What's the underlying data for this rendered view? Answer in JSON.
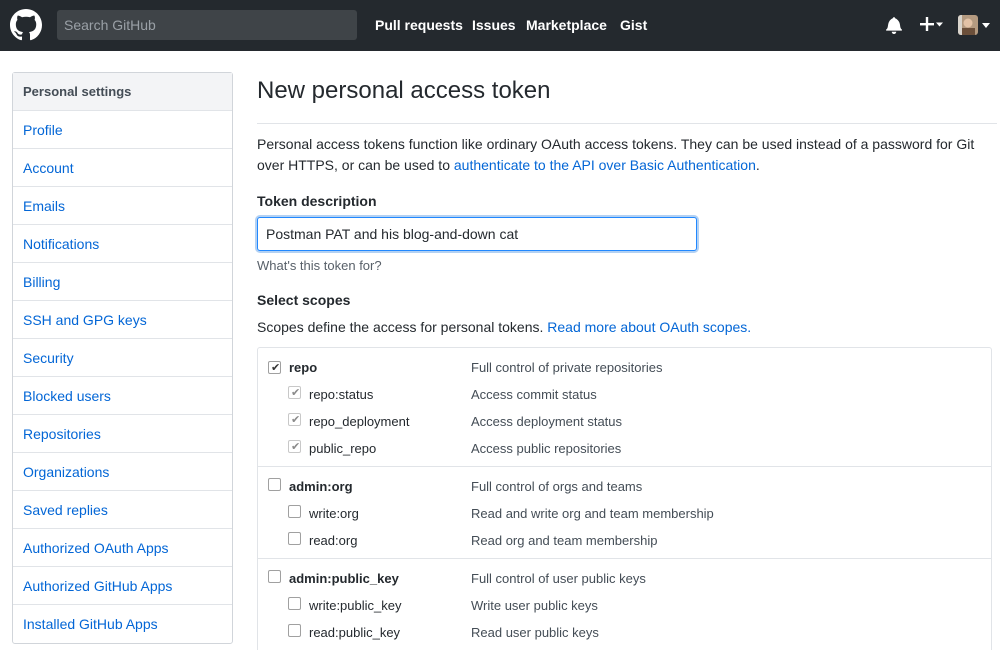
{
  "header": {
    "search_placeholder": "Search GitHub",
    "nav": [
      "Pull requests",
      "Issues",
      "Marketplace",
      "Gist"
    ]
  },
  "sidebar": {
    "heading": "Personal settings",
    "items": [
      {
        "label": "Profile"
      },
      {
        "label": "Account"
      },
      {
        "label": "Emails"
      },
      {
        "label": "Notifications"
      },
      {
        "label": "Billing"
      },
      {
        "label": "SSH and GPG keys"
      },
      {
        "label": "Security"
      },
      {
        "label": "Blocked users"
      },
      {
        "label": "Repositories"
      },
      {
        "label": "Organizations"
      },
      {
        "label": "Saved replies"
      },
      {
        "label": "Authorized OAuth Apps"
      },
      {
        "label": "Authorized GitHub Apps"
      },
      {
        "label": "Installed GitHub Apps"
      }
    ]
  },
  "main": {
    "title": "New personal access token",
    "intro_text": "Personal access tokens function like ordinary OAuth access tokens. They can be used instead of a password for Git over HTTPS, or can be used to ",
    "intro_link": "authenticate to the API over Basic Authentication",
    "intro_end": ".",
    "token_label": "Token description",
    "token_value": "Postman PAT and his blog-and-down cat",
    "token_hint": "What's this token for?",
    "scopes_label": "Select scopes",
    "scopes_note": "Scopes define the access for personal tokens. ",
    "scopes_link": "Read more about OAuth scopes."
  },
  "scopes": [
    {
      "name": "repo",
      "description": "Full control of private repositories",
      "checked": true,
      "children": [
        {
          "name": "repo:status",
          "description": "Access commit status",
          "checked": true
        },
        {
          "name": "repo_deployment",
          "description": "Access deployment status",
          "checked": true
        },
        {
          "name": "public_repo",
          "description": "Access public repositories",
          "checked": true
        }
      ]
    },
    {
      "name": "admin:org",
      "description": "Full control of orgs and teams",
      "checked": false,
      "children": [
        {
          "name": "write:org",
          "description": "Read and write org and team membership",
          "checked": false
        },
        {
          "name": "read:org",
          "description": "Read org and team membership",
          "checked": false
        }
      ]
    },
    {
      "name": "admin:public_key",
      "description": "Full control of user public keys",
      "checked": false,
      "children": [
        {
          "name": "write:public_key",
          "description": "Write user public keys",
          "checked": false
        },
        {
          "name": "read:public_key",
          "description": "Read user public keys",
          "checked": false
        }
      ]
    }
  ]
}
